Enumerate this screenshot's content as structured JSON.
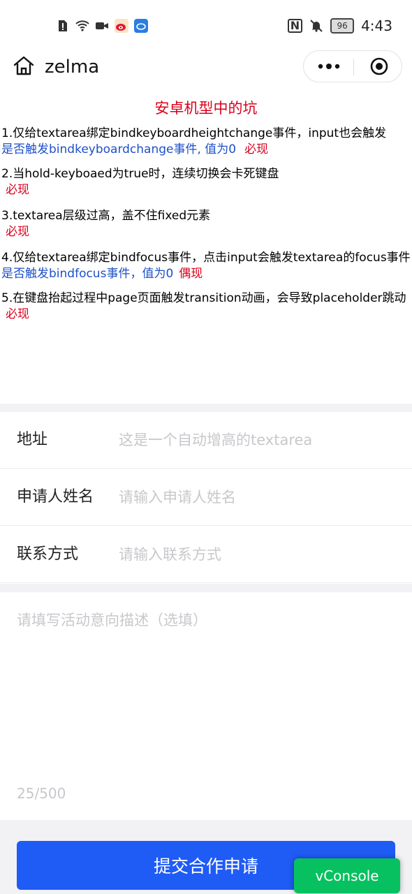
{
  "status_bar": {
    "left_icons": [
      "alert-sim-icon",
      "wifi-icon",
      "video-icon",
      "weibo-icon",
      "app-icon"
    ],
    "nfc_label": "N",
    "battery": "96",
    "time": "4:43"
  },
  "nav": {
    "title": "zelma"
  },
  "notes": {
    "title": "安卓机型中的坑",
    "items": [
      {
        "text": "1.仅给textarea绑定bindkeyboardheightchange事件，input也会触发",
        "blue": "是否触发bindkeyboardchange事件, 值为0",
        "status": "必现"
      },
      {
        "text": "2.当hold-keyboaed为true时，连续切换会卡死键盘",
        "status": "必现"
      },
      {
        "text": "3.textarea层级过高，盖不住fixed元素",
        "status": "必现"
      },
      {
        "text": "4.仅给textarea绑定bindfocus事件，点击input会触发textarea的focus事件",
        "blue": "是否触发bindfocus事件，值为0",
        "status": "偶现"
      },
      {
        "text": "5.在键盘抬起过程中page页面触发transition动画，会导致placeholder跳动",
        "status": "必现"
      }
    ]
  },
  "form": {
    "address_label": "地址",
    "address_placeholder": "这是一个自动增高的textarea",
    "name_label": "申请人姓名",
    "name_placeholder": "请输入申请人姓名",
    "contact_label": "联系方式",
    "contact_placeholder": "请输入联系方式",
    "desc_placeholder": "请填写活动意向描述（选填）",
    "counter": "25/500",
    "submit_label": "提交合作申请"
  },
  "vconsole_label": "vConsole",
  "colors": {
    "primary": "#1f5bf5",
    "warning_red": "#d9001b",
    "link_blue": "#1e50c8",
    "vconsole_green": "#07c160"
  }
}
